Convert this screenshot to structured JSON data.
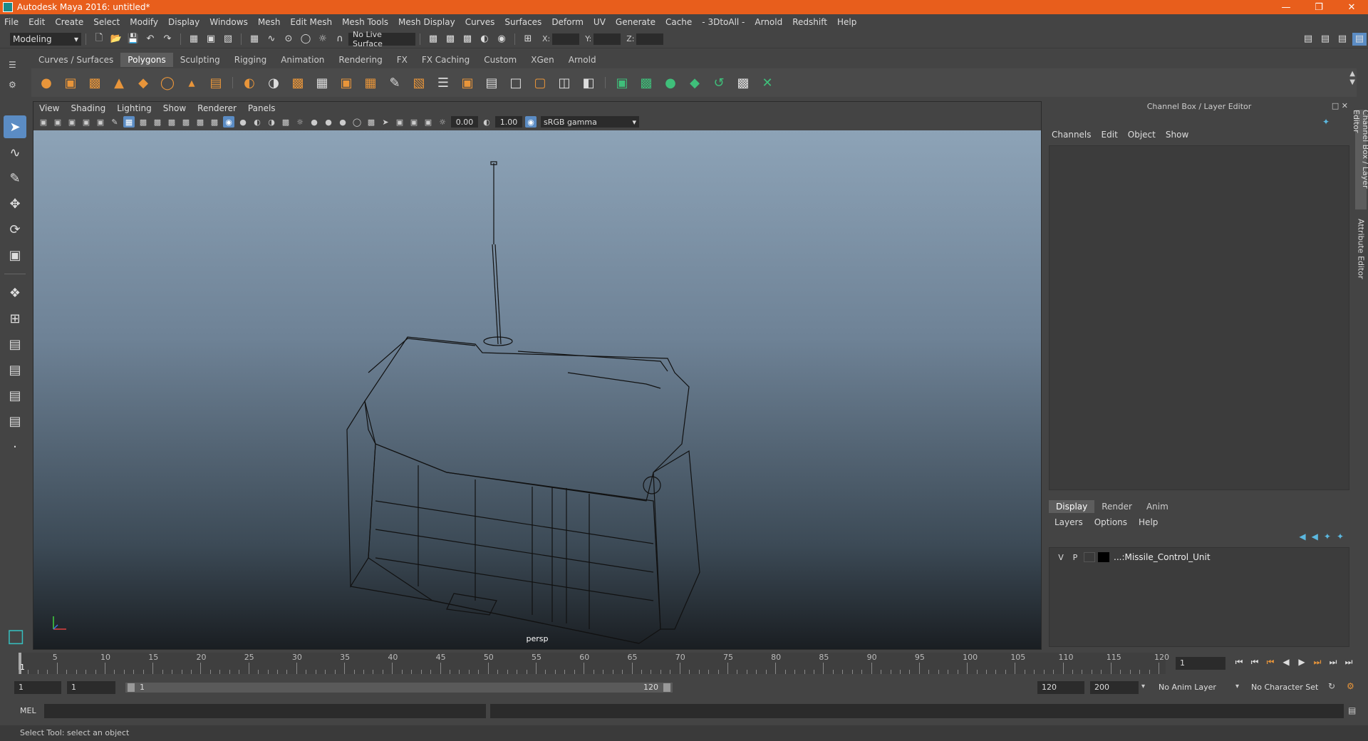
{
  "app": {
    "title": "Autodesk Maya 2016: untitled*",
    "accent": "#e85e1c"
  },
  "menu": [
    "File",
    "Edit",
    "Create",
    "Select",
    "Modify",
    "Display",
    "Windows",
    "Mesh",
    "Edit Mesh",
    "Mesh Tools",
    "Mesh Display",
    "Curves",
    "Surfaces",
    "Deform",
    "UV",
    "Generate",
    "Cache",
    "- 3DtoAll -",
    "Arnold",
    "Redshift",
    "Help"
  ],
  "statusline": {
    "mode": "Modeling",
    "live_surface": "No Live Surface",
    "x_label": "X:",
    "y_label": "Y:",
    "z_label": "Z:"
  },
  "shelf": {
    "tabs": [
      "Curves / Surfaces",
      "Polygons",
      "Sculpting",
      "Rigging",
      "Animation",
      "Rendering",
      "FX",
      "FX Caching",
      "Custom",
      "XGen",
      "Arnold"
    ],
    "active_tab": "Polygons"
  },
  "viewport": {
    "menu": [
      "View",
      "Shading",
      "Lighting",
      "Show",
      "Renderer",
      "Panels"
    ],
    "exposure": "0.00",
    "gamma": "1.00",
    "color_space": "sRGB gamma",
    "camera": "persp"
  },
  "channel_box": {
    "title": "Channel Box / Layer Editor",
    "menu": [
      "Channels",
      "Edit",
      "Object",
      "Show"
    ]
  },
  "layer_editor": {
    "tabs": [
      "Display",
      "Render",
      "Anim"
    ],
    "active_tab": "Display",
    "menu": [
      "Layers",
      "Options",
      "Help"
    ],
    "layers": [
      {
        "v": "V",
        "p": "P",
        "name": "...:Missile_Control_Unit"
      }
    ]
  },
  "side_tabs": {
    "channel": "Channel Box / Layer Editor",
    "attribute": "Attribute Editor"
  },
  "timeline": {
    "ticks": [
      "5",
      "10",
      "15",
      "20",
      "25",
      "30",
      "35",
      "40",
      "45",
      "50",
      "55",
      "60",
      "65",
      "70",
      "75",
      "80",
      "85",
      "90",
      "95",
      "100",
      "105",
      "110",
      "115",
      "120"
    ],
    "start_label": "1",
    "current_frame": "1"
  },
  "range": {
    "start": "1",
    "playback_start": "1",
    "bar_start": "1",
    "bar_end": "120",
    "playback_end": "120",
    "end": "200",
    "anim_layer": "No Anim Layer",
    "character_set": "No Character Set"
  },
  "command": {
    "label": "MEL",
    "help": "Select Tool: select an object"
  }
}
